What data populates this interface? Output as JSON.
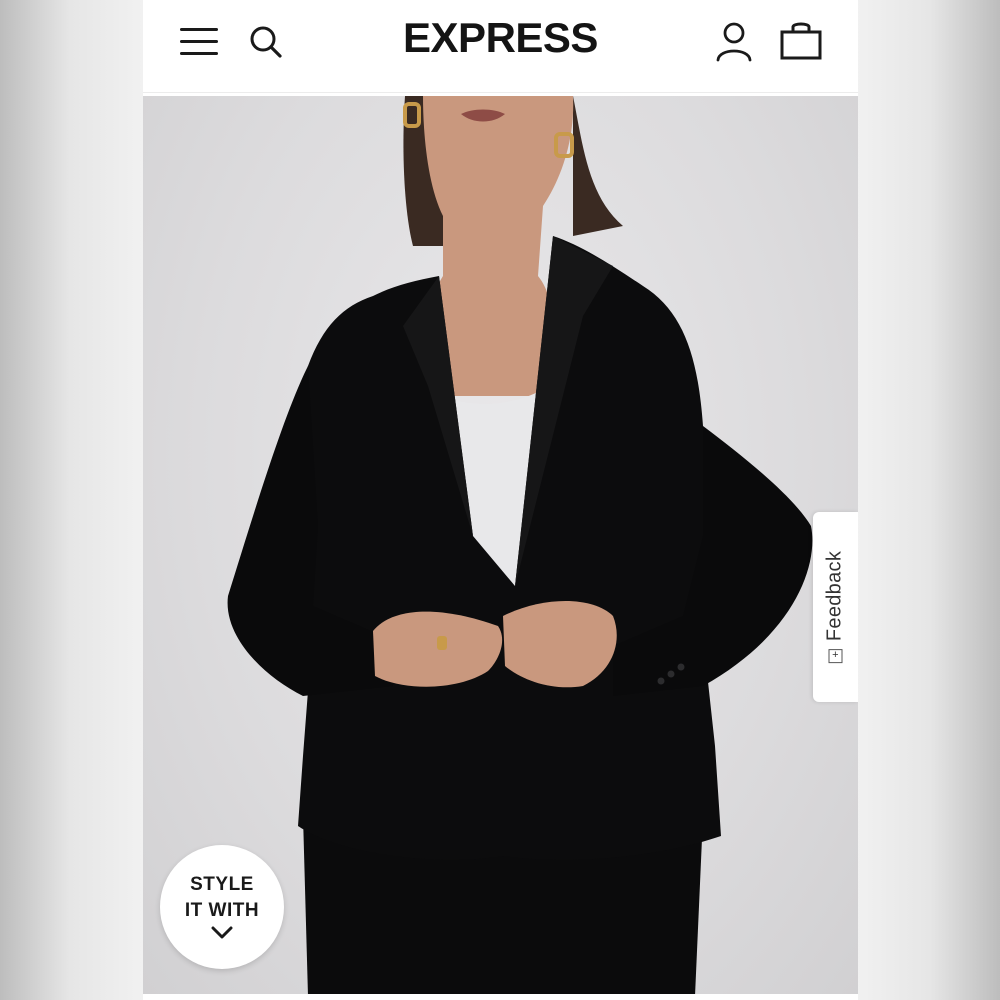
{
  "header": {
    "logo_text": "EXPRESS",
    "menu_icon": "hamburger-menu-icon",
    "search_icon": "search-icon",
    "account_icon": "account-icon",
    "bag_icon": "shopping-bag-icon"
  },
  "hero": {
    "image_subject": "model-wearing-black-blazer-over-white-top"
  },
  "feedback": {
    "label": "Feedback",
    "icon_glyph": "+",
    "icon": "feedback-icon"
  },
  "style_it_with": {
    "line1": "STYLE",
    "line2": "IT WITH",
    "icon": "chevron-down-icon"
  },
  "colors": {
    "logo": "#141414",
    "background": "#ffffff",
    "hero_background": "#dcdbdd",
    "blazer": "#0c0c0d"
  }
}
